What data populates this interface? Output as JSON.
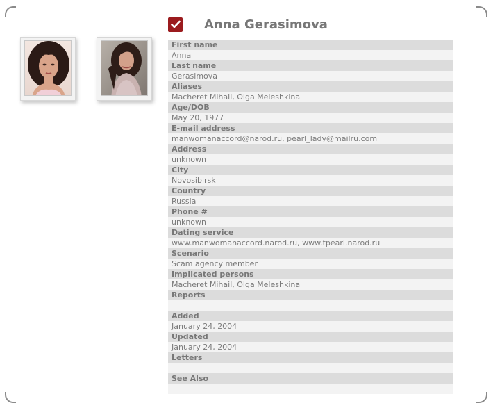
{
  "profile": {
    "first_name": "Anna",
    "last_name": "Gerasimova",
    "display_name": "Anna Gerasimova",
    "checked": true
  },
  "photos": [
    {
      "icon": "profile-photo-1"
    },
    {
      "icon": "profile-photo-2"
    }
  ],
  "fields": [
    {
      "label": "First name",
      "value": "Anna"
    },
    {
      "label": "Last name",
      "value": "Gerasimova"
    },
    {
      "label": "Aliases",
      "value": "Macheret Mihail, Olga Meleshkina"
    },
    {
      "label": "Age/DOB",
      "value": "May 20, 1977"
    },
    {
      "label": "E-mail address",
      "value": "manwomanaccord@narod.ru, pearl_lady@mailru.com"
    },
    {
      "label": "Address",
      "value": "unknown"
    },
    {
      "label": "City",
      "value": "Novosibirsk"
    },
    {
      "label": "Country",
      "value": "Russia"
    },
    {
      "label": "Phone #",
      "value": "unknown"
    },
    {
      "label": "Dating service",
      "value": "www.manwomanaccord.narod.ru, www.tpearl.narod.ru"
    },
    {
      "label": "Scenario",
      "value": "Scam agency member"
    },
    {
      "label": "Implicated persons",
      "value": "Macheret Mihail, Olga Meleshkina"
    },
    {
      "label": "Reports",
      "value": ""
    },
    {
      "label": "Added",
      "value": "January 24, 2004"
    },
    {
      "label": "Updated",
      "value": "January 24, 2004"
    },
    {
      "label": "Letters",
      "value": ""
    },
    {
      "label": "See Also",
      "value": ""
    }
  ],
  "colors": {
    "accent": "#9b1b1e",
    "label_bg": "#dcdcdc",
    "value_bg": "#f3f3f3",
    "text": "#777777"
  }
}
